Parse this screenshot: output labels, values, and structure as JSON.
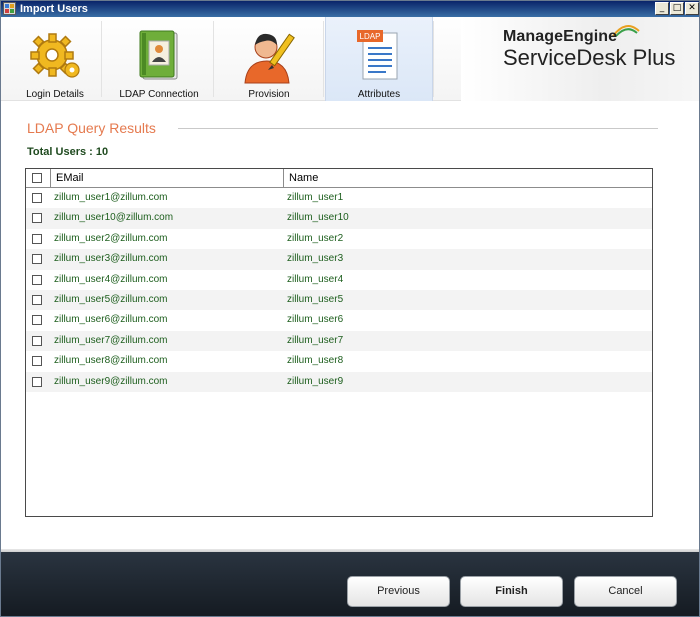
{
  "window": {
    "title": "Import Users",
    "controls": {
      "minimize": "_",
      "maximize": "□",
      "close": "✕"
    }
  },
  "tabs": [
    {
      "label": "Login Details",
      "icon": "gear-icon"
    },
    {
      "label": "LDAP Connection",
      "icon": "address-book-icon"
    },
    {
      "label": "Provision",
      "icon": "user-edit-icon"
    },
    {
      "label": "Attributes",
      "icon": "ldap-document-icon",
      "badge": "LDAP",
      "active": true
    }
  ],
  "brand": {
    "company": "ManageEngine",
    "product": "ServiceDesk Plus"
  },
  "section": {
    "title": "LDAP Query Results",
    "total": "Total Users : 10"
  },
  "grid": {
    "columns": {
      "email": "EMail",
      "name": "Name"
    },
    "rows": [
      {
        "email": "zillum_user1@zillum.com",
        "name": "zillum_user1"
      },
      {
        "email": "zillum_user10@zillum.com",
        "name": "zillum_user10"
      },
      {
        "email": "zillum_user2@zillum.com",
        "name": "zillum_user2"
      },
      {
        "email": "zillum_user3@zillum.com",
        "name": "zillum_user3"
      },
      {
        "email": "zillum_user4@zillum.com",
        "name": "zillum_user4"
      },
      {
        "email": "zillum_user5@zillum.com",
        "name": "zillum_user5"
      },
      {
        "email": "zillum_user6@zillum.com",
        "name": "zillum_user6"
      },
      {
        "email": "zillum_user7@zillum.com",
        "name": "zillum_user7"
      },
      {
        "email": "zillum_user8@zillum.com",
        "name": "zillum_user8"
      },
      {
        "email": "zillum_user9@zillum.com",
        "name": "zillum_user9"
      }
    ]
  },
  "buttons": {
    "previous": "Previous",
    "finish": "Finish",
    "cancel": "Cancel"
  },
  "colors": {
    "accent": "#e57a4f",
    "cell_text": "#1d5e1d",
    "footer": "#1b222b"
  }
}
